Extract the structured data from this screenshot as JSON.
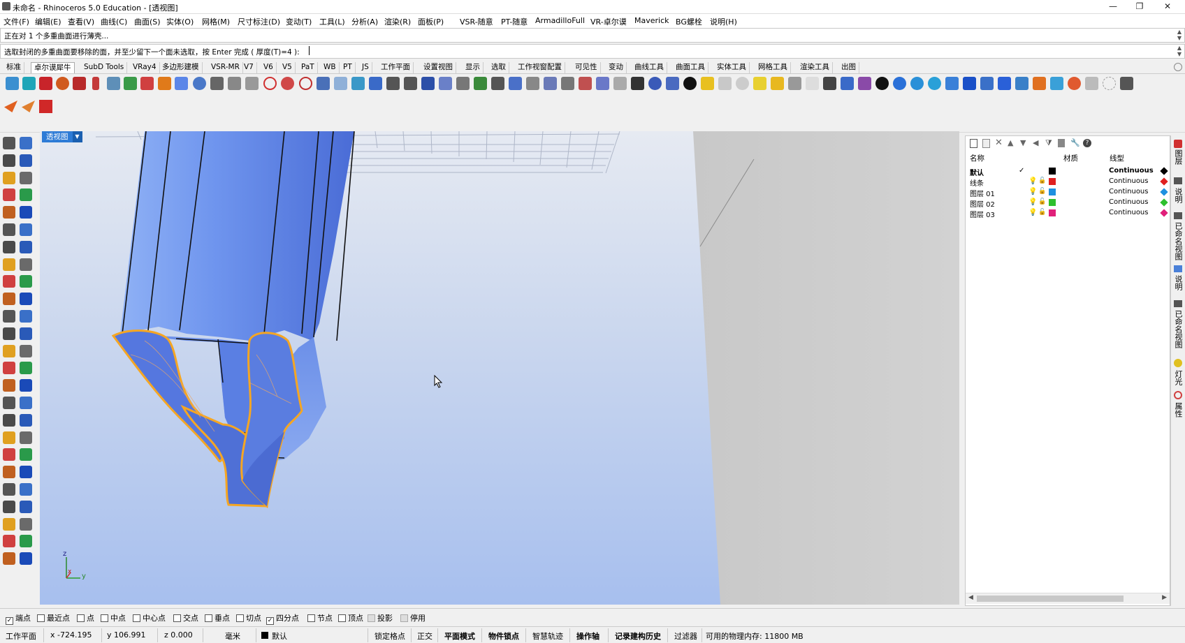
{
  "window": {
    "title": "未命名 - Rhinoceros 5.0 Education - [透视图]",
    "min_icon": "minimize-icon",
    "max_icon": "restore-icon",
    "close_icon": "close-icon"
  },
  "menu": [
    "文件(F)",
    "编辑(E)",
    "查看(V)",
    "曲线(C)",
    "曲面(S)",
    "实体(O)",
    "网格(M)",
    "尺寸标注(D)",
    "变动(T)",
    "工具(L)",
    "分析(A)",
    "渲染(R)",
    "面板(P)",
    "VSR-随意",
    "PT-随意",
    "ArmadilloFull",
    "VR-卓尔谟",
    "Maverick",
    "BG螺栓",
    "说明(H)"
  ],
  "command": {
    "history": "正在对 1 个多重曲面进行薄壳...",
    "prompt": "选取封闭的多重曲面要移除的面，并至少留下一个面未选取，按 Enter 完成 ( 厚度(T)=4 ):"
  },
  "toolbar_tabs": [
    "标准",
    "卓尔谟犀牛",
    "SubD Tools",
    "VRay4",
    "多边形建模",
    "VSR-MR",
    "V7",
    "V6",
    "V5",
    "PaT",
    "WB",
    "PT",
    "JS",
    "工作平面",
    "设置视图",
    "显示",
    "选取",
    "工作视窗配置",
    "可见性",
    "变动",
    "曲线工具",
    "曲面工具",
    "实体工具",
    "网格工具",
    "渲染工具",
    "出图"
  ],
  "active_tab": 1,
  "viewport": {
    "label": "透视图",
    "axis_z": "z",
    "axis_x": "x",
    "axis_y": "y"
  },
  "layers": {
    "headers": {
      "name": "名称",
      "material": "材质",
      "linetype": "线型"
    },
    "rows": [
      {
        "name": "默认",
        "check": "✓",
        "color": "#000000",
        "linetype": "Continuous",
        "bold": true
      },
      {
        "name": "线条",
        "color": "#e02020",
        "linetype": "Continuous"
      },
      {
        "name": "图层 01",
        "color": "#1e90e0",
        "linetype": "Continuous"
      },
      {
        "name": "图层 02",
        "color": "#2ec02e",
        "linetype": "Continuous"
      },
      {
        "name": "图层 03",
        "color": "#e0207a",
        "linetype": "Continuous"
      }
    ]
  },
  "side_panels": [
    "图层",
    "说明",
    "已命名视图",
    "说明",
    "已命名视图",
    "灯光",
    "属性"
  ],
  "osnaps": [
    {
      "label": "端点",
      "checked": true
    },
    {
      "label": "最近点",
      "checked": false
    },
    {
      "label": "点",
      "checked": false
    },
    {
      "label": "中点",
      "checked": false
    },
    {
      "label": "中心点",
      "checked": false
    },
    {
      "label": "交点",
      "checked": false
    },
    {
      "label": "垂点",
      "checked": false
    },
    {
      "label": "切点",
      "checked": false
    },
    {
      "label": "四分点",
      "checked": true
    },
    {
      "label": "节点",
      "checked": false
    },
    {
      "label": "顶点",
      "checked": false
    },
    {
      "label": "投影",
      "checked": false
    },
    {
      "label": "停用",
      "checked": false
    }
  ],
  "status": {
    "cplane": "工作平面",
    "x": "x -724.195",
    "y": "y 106.991",
    "z": "z 0.000",
    "units": "毫米",
    "layer": "默认",
    "buttons": [
      "锁定格点",
      "正交",
      "平面模式",
      "物件锁点",
      "智慧轨迹",
      "操作轴",
      "记录建构历史",
      "过滤器"
    ],
    "memory": "可用的物理内存: 11800 MB"
  },
  "colors": {
    "accent": "#2d7bd6",
    "selection": "#f5a623",
    "object": "#5b86e8"
  }
}
